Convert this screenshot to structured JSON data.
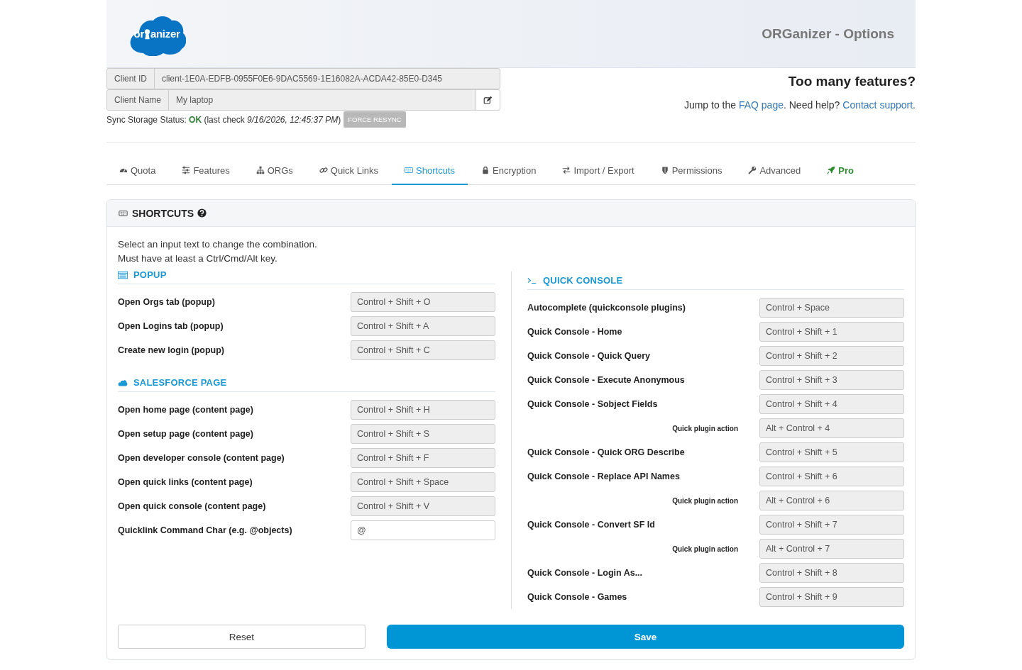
{
  "header": {
    "logo": [
      "or",
      "anizer"
    ],
    "title": "ORGanizer - Options"
  },
  "client": {
    "id_label": "Client ID",
    "id_value": "client-1E0A-EDFB-0955F0E6-9DAC5569-1E16082A-ACDA42-85E0-D345",
    "name_label": "Client Name",
    "name_value": "My laptop",
    "status": "Sync Storage Status: **OK**  (last check *9/16/2026, 12:45:37 PM*)",
    "resync_button": "FORCE RESYNC"
  },
  "help": {
    "title": "Too many features?",
    "sentence": [
      {
        "kind": "text",
        "text": "Jump to the "
      },
      {
        "kind": "link",
        "text": "FAQ page"
      },
      {
        "kind": "text",
        "text": ". Need help? "
      },
      {
        "kind": "link",
        "text": "Contact support"
      },
      {
        "kind": "text",
        "text": "."
      }
    ]
  },
  "tabs": [
    {
      "label": "Quota",
      "selected": false,
      "kind": "plain"
    },
    {
      "label": "Features",
      "selected": false,
      "kind": "plain"
    },
    {
      "label": "ORGs",
      "selected": false,
      "kind": "plain"
    },
    {
      "label": "Quick Links",
      "selected": false,
      "kind": "plain"
    },
    {
      "label": "Shortcuts",
      "selected": true,
      "kind": "plain"
    },
    {
      "label": "Encryption",
      "selected": false,
      "kind": "plain"
    },
    {
      "label": "Import / Export",
      "selected": false,
      "kind": "plain"
    },
    {
      "label": "Permissions",
      "selected": false,
      "kind": "plain"
    },
    {
      "label": "Advanced",
      "selected": false,
      "kind": "plain"
    },
    {
      "label": "Pro",
      "selected": false,
      "kind": "pro"
    }
  ],
  "panel": {
    "title": "SHORTCUTS",
    "intro": [
      "Select an input text to change the combination.",
      "Must have at least a Ctrl/Cmd/Alt key."
    ],
    "columns": [
      {
        "sections": [
          {
            "title": "POPUP",
            "rows": [
              {
                "kind": "main",
                "label": "Open Orgs tab (popup)",
                "value": "Control + Shift + O",
                "readonly": true
              },
              {
                "kind": "main",
                "label": "Open Logins tab (popup)",
                "value": "Control + Shift + A",
                "readonly": true
              },
              {
                "kind": "main",
                "label": "Create new login (popup)",
                "value": "Control + Shift + C",
                "readonly": true
              }
            ]
          },
          {
            "title": "SALESFORCE PAGE",
            "rows": [
              {
                "kind": "main",
                "label": "Open home page (content page)",
                "value": "Control + Shift + H",
                "readonly": true
              },
              {
                "kind": "main",
                "label": "Open setup page (content page)",
                "value": "Control + Shift + S",
                "readonly": true
              },
              {
                "kind": "main",
                "label": "Open developer console (content page)",
                "value": "Control + Shift + F",
                "readonly": true
              },
              {
                "kind": "main",
                "label": "Open quick links (content page)",
                "value": "Control + Shift + Space",
                "readonly": true
              },
              {
                "kind": "main",
                "label": "Open quick console (content page)",
                "value": "Control + Shift + V",
                "readonly": true
              },
              {
                "kind": "main",
                "label": "Quicklink Command Char (e.g. @objects)",
                "value": "@",
                "readonly": false
              }
            ]
          }
        ]
      },
      {
        "sections": [
          {
            "title": "QUICK CONSOLE",
            "rows": [
              {
                "kind": "main",
                "label": "Autocomplete (quickconsole plugins)",
                "value": "Control + Space",
                "readonly": true
              },
              {
                "kind": "main",
                "label": "Quick Console - Home",
                "value": "Control + Shift + 1",
                "readonly": true
              },
              {
                "kind": "main",
                "label": "Quick Console - Quick Query",
                "value": "Control + Shift + 2",
                "readonly": true
              },
              {
                "kind": "main",
                "label": "Quick Console - Execute Anonymous",
                "value": "Control + Shift + 3",
                "readonly": true
              },
              {
                "kind": "main",
                "label": "Quick Console - Sobject Fields",
                "value": "Control + Shift + 4",
                "readonly": true
              },
              {
                "kind": "sub",
                "label": "Quick plugin action",
                "value": "Alt + Control + 4",
                "readonly": true
              },
              {
                "kind": "main",
                "label": "Quick Console - Quick ORG Describe",
                "value": "Control + Shift + 5",
                "readonly": true
              },
              {
                "kind": "main",
                "label": "Quick Console - Replace API Names",
                "value": "Control + Shift + 6",
                "readonly": true
              },
              {
                "kind": "sub",
                "label": "Quick plugin action",
                "value": "Alt + Control + 6",
                "readonly": true
              },
              {
                "kind": "main",
                "label": "Quick Console - Convert SF Id",
                "value": "Control + Shift + 7",
                "readonly": true
              },
              {
                "kind": "sub",
                "label": "Quick plugin action",
                "value": "Alt + Control + 7",
                "readonly": true
              },
              {
                "kind": "main",
                "label": "Quick Console - Login As...",
                "value": "Control + Shift + 8",
                "readonly": true
              },
              {
                "kind": "main",
                "label": "Quick Console - Games",
                "value": "Control + Shift + 9",
                "readonly": true
              }
            ]
          }
        ]
      }
    ]
  },
  "buttons": {
    "reset": "Reset",
    "save": "Save"
  }
}
